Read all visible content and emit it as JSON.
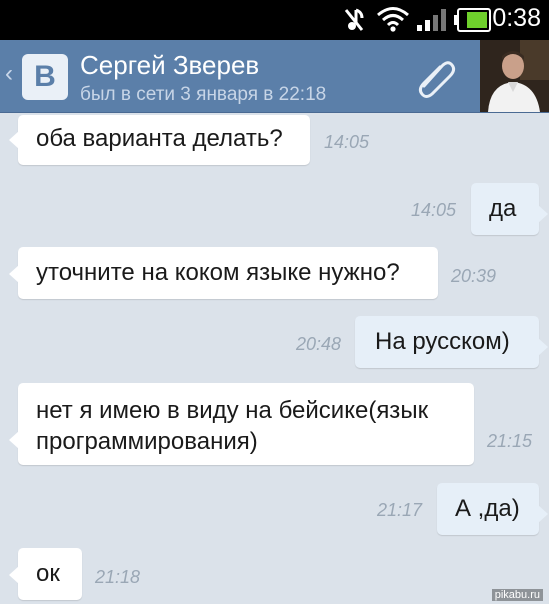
{
  "status_bar": {
    "time": "0:38",
    "icons": [
      "muted-icon",
      "wifi-icon",
      "signal-icon",
      "battery-icon"
    ]
  },
  "header": {
    "logo_letter": "B",
    "contact_name": "Сергей Зверев",
    "contact_status": "был в сети 3 января в 22:18",
    "icons": [
      "back-chevron-icon",
      "vk-logo",
      "attach-icon",
      "avatar"
    ]
  },
  "messages": [
    {
      "direction": "in",
      "text": "оба варианта делать?",
      "time": "14:05"
    },
    {
      "direction": "out",
      "text": "да",
      "time": "14:05"
    },
    {
      "direction": "in",
      "text": "уточните на коком языке нужно?",
      "time": "20:39"
    },
    {
      "direction": "out",
      "text": "На русском)",
      "time": "20:48"
    },
    {
      "direction": "in",
      "text_line1": "нет я имею в виду на бейсике(язык",
      "text_line2": "программирования)",
      "time": "21:15"
    },
    {
      "direction": "out",
      "text": "А ,да)",
      "time": "21:17"
    },
    {
      "direction": "in",
      "text": "ок",
      "time": "21:18"
    }
  ],
  "watermark": "pikabu.ru",
  "colors": {
    "header_bg": "#5b7fa9",
    "chat_bg": "#dbe2ea",
    "incoming_bubble": "#ffffff",
    "outgoing_bubble": "#e6eff8",
    "time_text": "#9aa7b5"
  }
}
